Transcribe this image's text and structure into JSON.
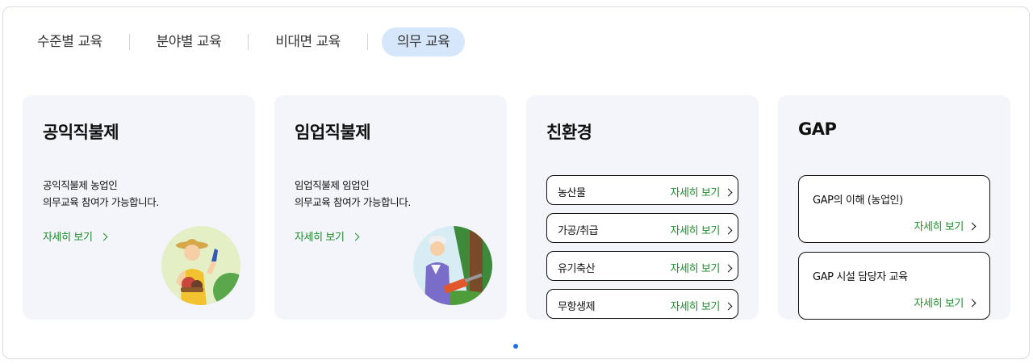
{
  "tabs": [
    {
      "label": "수준별 교육"
    },
    {
      "label": "분야별 교육"
    },
    {
      "label": "비대면 교육"
    },
    {
      "label": "의무 교육",
      "active": true
    }
  ],
  "cards": [
    {
      "title": "공익직불제",
      "desc_line1": "공익직불제 농업인",
      "desc_line2": "의무교육 참여가 가능합니다.",
      "link": "자세히 보기",
      "illustration": "farmer-illustration"
    },
    {
      "title": "임업직불제",
      "desc_line1": "임업직불제 임업인",
      "desc_line2": "의무교육 참여가 가능합니다.",
      "link": "자세히 보기",
      "illustration": "forester-illustration"
    },
    {
      "title": "친환경",
      "items": [
        {
          "label": "농산물",
          "link": "자세히 보기"
        },
        {
          "label": "가공/취급",
          "link": "자세히 보기"
        },
        {
          "label": "유기축산",
          "link": "자세히 보기"
        },
        {
          "label": "무항생제",
          "link": "자세히 보기"
        }
      ]
    },
    {
      "title": "GAP",
      "items": [
        {
          "label": "GAP의 이해 (농업인)",
          "link": "자세히 보기"
        },
        {
          "label": "GAP 시설 담당자 교육",
          "link": "자세히 보기"
        }
      ]
    }
  ],
  "pagination": {
    "total": 1,
    "current": 1
  },
  "colors": {
    "accent_green": "#1f8b2e",
    "active_tab_bg": "#d6e7fb",
    "card_bg": "#f3f5fa",
    "dot": "#1a73e8"
  }
}
